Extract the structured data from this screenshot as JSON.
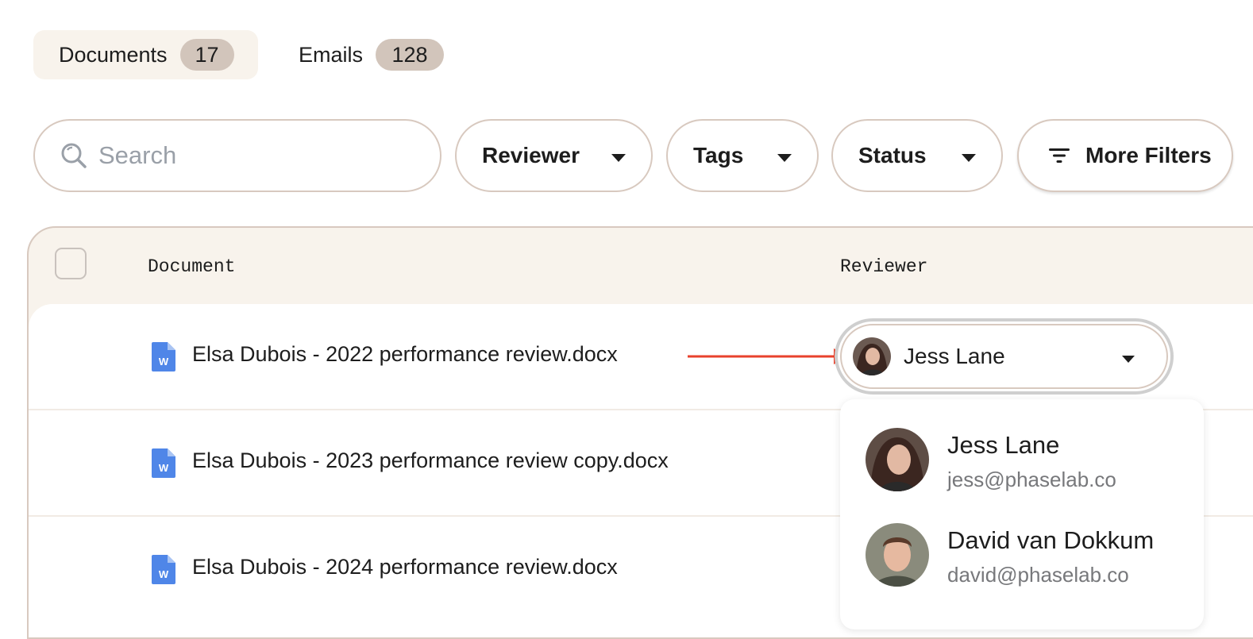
{
  "tabs": [
    {
      "label": "Documents",
      "count": "17",
      "active": true
    },
    {
      "label": "Emails",
      "count": "128",
      "active": false
    }
  ],
  "filters": {
    "search_placeholder": "Search",
    "reviewer": "Reviewer",
    "tags": "Tags",
    "status": "Status",
    "more": "More Filters"
  },
  "table": {
    "columns": [
      "Document",
      "Reviewer"
    ],
    "rows": [
      {
        "document": "Elsa Dubois - 2022 performance review.docx"
      },
      {
        "document": "Elsa Dubois - 2023 performance review copy.docx"
      },
      {
        "document": "Elsa Dubois - 2024 performance review.docx"
      }
    ],
    "selected_reviewer": "Jess Lane"
  },
  "dropdown": {
    "options": [
      {
        "name": "Jess Lane",
        "email": "jess@phaselab.co"
      },
      {
        "name": "David van Dokkum",
        "email": "david@phaselab.co"
      }
    ]
  },
  "colors": {
    "accent_bg": "#f8f3ec",
    "badge": "#d2c5bb",
    "border": "#d8c9bf",
    "arrow": "#e8412c",
    "doc_icon": "#4f86e8"
  },
  "icons": [
    "search-icon",
    "chevron-down-icon",
    "filter-icon",
    "word-doc-icon",
    "avatar"
  ]
}
